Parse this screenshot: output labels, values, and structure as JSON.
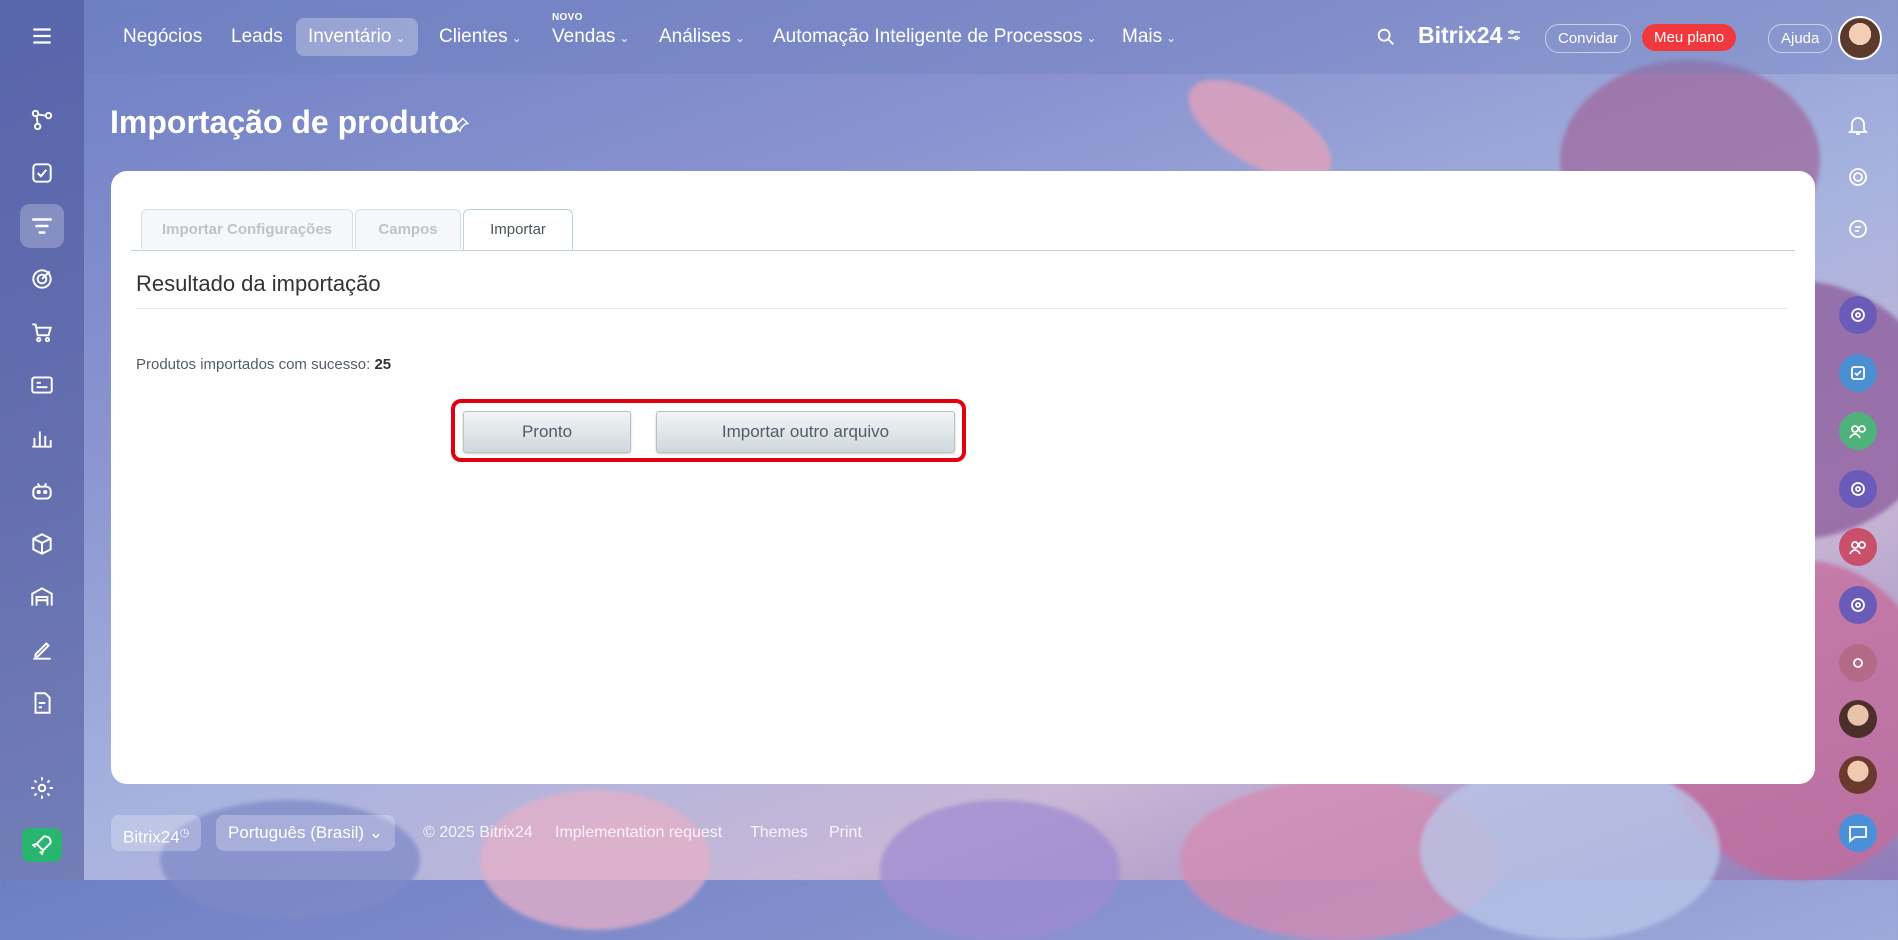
{
  "top_nav": {
    "items": [
      {
        "label": "Negócios"
      },
      {
        "label": "Leads"
      },
      {
        "label": "Inventário"
      },
      {
        "label": "Clientes"
      },
      {
        "label": "Vendas"
      },
      {
        "label": "Análises"
      },
      {
        "label": "Automação Inteligente de Processos"
      },
      {
        "label": "Mais"
      }
    ],
    "new_badge": "NOVO",
    "brand": "Bitrix24",
    "invite_label": "Convidar",
    "plan_label": "Meu plano",
    "help_label": "Ajuda"
  },
  "page": {
    "title": "Importação de produto"
  },
  "tabs": [
    {
      "label": "Importar Configurações"
    },
    {
      "label": "Campos"
    },
    {
      "label": "Importar"
    }
  ],
  "content": {
    "section_title": "Resultado da importação",
    "result_label": "Produtos importados com sucesso:",
    "result_count": "25",
    "done_button": "Pronto",
    "import_other_button": "Importar outro arquivo"
  },
  "footer": {
    "brand_label": "Bitrix24",
    "language_label": "Português (Brasil)",
    "copyright": "© 2025 Bitrix24",
    "implementation_link": "Implementation request",
    "themes_link": "Themes",
    "print_link": "Print"
  },
  "colors": {
    "accent_red": "#f0383d",
    "highlight": "#e0000f",
    "rocket_green": "#27b56f"
  }
}
